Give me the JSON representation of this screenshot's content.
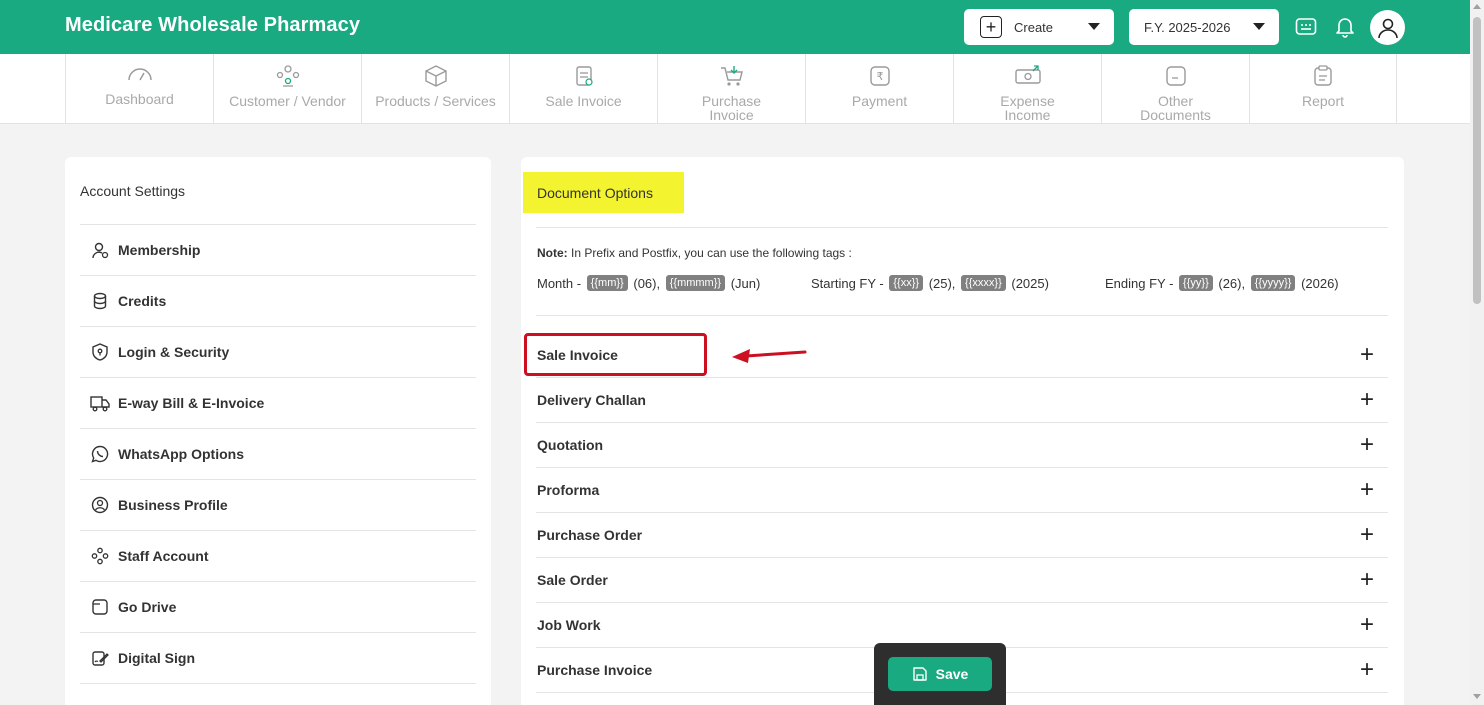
{
  "header": {
    "brand": "Medicare Wholesale Pharmacy",
    "create_label": "Create",
    "fy_label": "F.Y. 2025-2026",
    "brand_color": "#1aaa82"
  },
  "nav": {
    "items": [
      {
        "label": "Dashboard",
        "icon": "gauge-icon"
      },
      {
        "label": "Customer / Vendor",
        "icon": "users-icon"
      },
      {
        "label": "Products / Services",
        "icon": "box-icon"
      },
      {
        "label": "Sale Invoice",
        "icon": "invoice-icon"
      },
      {
        "label": "Purchase Invoice",
        "icon": "cart-icon"
      },
      {
        "label": "Payment",
        "icon": "rupee-icon"
      },
      {
        "label": "Expense Income",
        "icon": "cash-icon"
      },
      {
        "label": "Other Documents",
        "icon": "document-icon"
      },
      {
        "label": "Report",
        "icon": "clipboard-icon"
      }
    ]
  },
  "account_settings": {
    "title": "Account Settings",
    "items": [
      {
        "label": "Membership",
        "icon": "membership-icon"
      },
      {
        "label": "Credits",
        "icon": "coins-icon"
      },
      {
        "label": "Login & Security",
        "icon": "shield-icon"
      },
      {
        "label": "E-way Bill & E-Invoice",
        "icon": "truck-icon"
      },
      {
        "label": "WhatsApp Options",
        "icon": "whatsapp-icon"
      },
      {
        "label": "Business Profile",
        "icon": "profile-icon"
      },
      {
        "label": "Staff Account",
        "icon": "staff-icon"
      },
      {
        "label": "Go Drive",
        "icon": "drive-icon"
      },
      {
        "label": "Digital Sign",
        "icon": "sign-icon"
      }
    ]
  },
  "document_options": {
    "title": "Document Options",
    "note_label": "Note:",
    "note_text": " In Prefix and Postfix, you can use the following tags :",
    "tags": {
      "month_label": "Month -",
      "month_tag1": "{{mm}}",
      "month_val1": "(06),",
      "month_tag2": "{{mmmm}}",
      "month_val2": "(Jun)",
      "sfy_label": "Starting FY -",
      "sfy_tag1": "{{xx}}",
      "sfy_val1": "(25),",
      "sfy_tag2": "{{xxxx}}",
      "sfy_val2": "(2025)",
      "efy_label": "Ending FY -",
      "efy_tag1": "{{yy}}",
      "efy_val1": "(26),",
      "efy_tag2": "{{yyyy}}",
      "efy_val2": "(2026)"
    },
    "sections": [
      "Sale Invoice",
      "Delivery Challan",
      "Quotation",
      "Proforma",
      "Purchase Order",
      "Sale Order",
      "Job Work",
      "Purchase Invoice"
    ],
    "expand_symbol": "+"
  },
  "save": {
    "label": "Save"
  }
}
